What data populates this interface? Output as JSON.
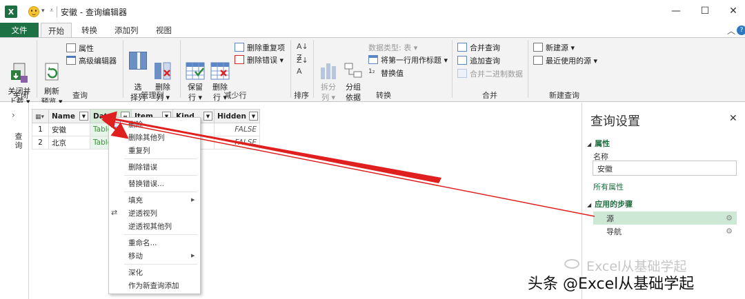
{
  "window": {
    "app_icon_letter": "X",
    "title": "安徽 - 查询编辑器",
    "minimize": "—",
    "maximize": "☐",
    "close": "✕",
    "help": "?",
    "collapse": "︿"
  },
  "tabs": [
    "文件",
    "开始",
    "转换",
    "添加列",
    "视图"
  ],
  "ribbon": {
    "close_load": "关闭并\n上载 ▾",
    "close_group": "关闭",
    "refresh": "刷新\n预览 ▾",
    "properties": "属性",
    "advanced_editor": "高级编辑器",
    "query_group": "查询",
    "choose_columns": "选\n择列",
    "remove_columns": "删除\n列 ▾",
    "manage_cols_group": "管理列",
    "keep_rows": "保留\n行 ▾",
    "remove_rows": "删除\n行 ▾",
    "remove_duplicates": "删除重复项",
    "remove_errors": "删除错误 ▾",
    "reduce_rows_group": "减少行",
    "sort_group": "排序",
    "split_column": "拆分\n列 ▾",
    "group_by": "分组\n依据",
    "data_type": "数据类型: 表 ▾",
    "first_row_header": "将第一行用作标题 ▾",
    "replace_values": "替换值",
    "transform_group": "转换",
    "merge_queries": "合并查询",
    "append_queries": "追加查询",
    "combine_binaries": "合并二进制数据",
    "combine_group": "合并",
    "new_source": "新建源 ▾",
    "recent_sources": "最近使用的源 ▾",
    "new_query_group": "新建查询"
  },
  "navigator": {
    "expand": "›",
    "label": "查询"
  },
  "grid": {
    "columns": [
      "Name",
      "Data",
      "Item",
      "Kind",
      "Hidden"
    ],
    "rows": [
      {
        "num": "1",
        "name": "安徽",
        "data": "Table",
        "hidden": "FALSE"
      },
      {
        "num": "2",
        "name": "北京",
        "data": "Table",
        "hidden": "FALSE"
      }
    ]
  },
  "context_menu": {
    "items": [
      "删除",
      "删除其他列",
      "重复列",
      "删除错误",
      "替换错误...",
      "填充",
      "逆透视列",
      "逆透视其他列",
      "重命名...",
      "移动",
      "深化",
      "作为新查询添加"
    ]
  },
  "settings": {
    "title": "查询设置",
    "close": "✕",
    "properties_header": "属性",
    "name_label": "名称",
    "name_value": "安徽",
    "all_properties": "所有属性",
    "steps_header": "应用的步骤",
    "steps": [
      "源",
      "导航"
    ]
  },
  "watermark": {
    "faint": "Excel从基础学起",
    "bold": "头条 @Excel从基础学起"
  },
  "colors": {
    "file_tab": "#1e7145",
    "accent_green": "#1e6f3f",
    "arrow_red": "#e0201f",
    "selected_step": "#cde8d4"
  }
}
